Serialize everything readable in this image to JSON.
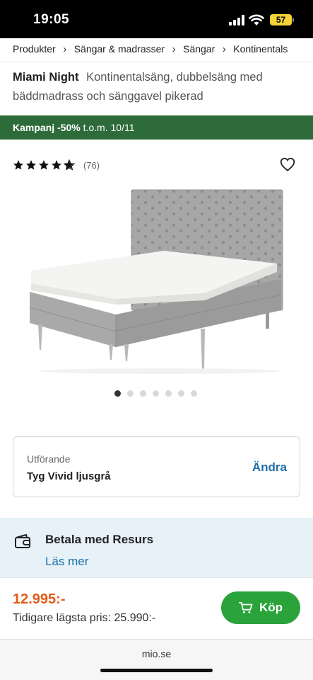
{
  "status_bar": {
    "time": "19:05",
    "battery": "57",
    "icons": [
      "signal-icon",
      "wifi-icon",
      "battery-icon"
    ]
  },
  "breadcrumb": [
    {
      "label": "Produkter"
    },
    {
      "label": "Sängar & madrasser"
    },
    {
      "label": "Sängar"
    },
    {
      "label": "Kontinentals"
    }
  ],
  "breadcrumb_separator": "›",
  "product": {
    "brand": "Miami Night",
    "description": "Kontinentalsäng, dubbelsäng med bäddmadrass och sänggavel pikerad",
    "rating": 4.5,
    "review_count": "(76)",
    "image_count": 7,
    "active_image": 1
  },
  "campaign": {
    "label": "Kampanj -50%",
    "period": "t.o.m. 10/11",
    "color": "#2e6b3b"
  },
  "variant": {
    "label": "Utförande",
    "value": "Tyg Vivid ljusgrå",
    "change_label": "Ändra"
  },
  "payment": {
    "title": "Betala med Resurs",
    "link": "Läs mer",
    "icon": "wallet-icon"
  },
  "price": {
    "current": "12.995:-",
    "previous": "Tidigare lägsta pris: 25.990:-",
    "buy_label": "Köp"
  },
  "browser": {
    "url": "mio.se"
  },
  "colors": {
    "accent_blue": "#1f6fa8",
    "price_orange": "#e25b17",
    "buy_green": "#29a33a",
    "payment_bg": "#e6f1f8"
  }
}
